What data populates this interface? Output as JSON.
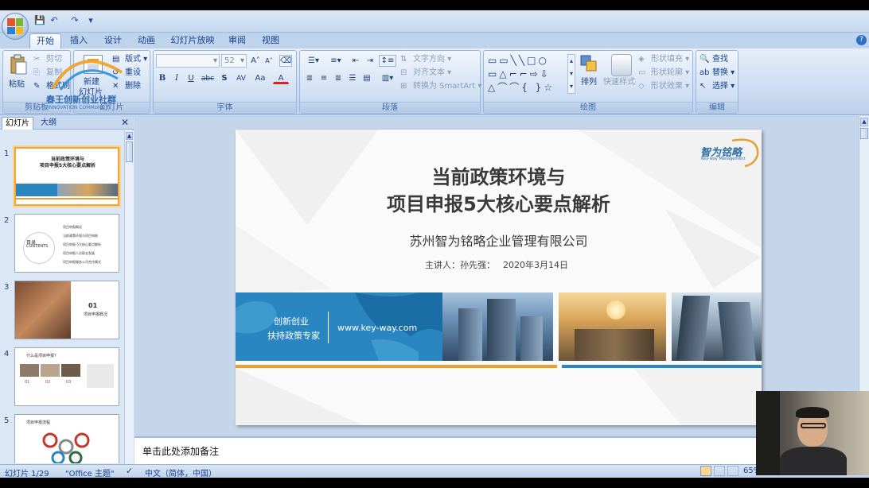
{
  "qat": {
    "save": "💾",
    "undo": "↶",
    "redo": "↷",
    "more": "▾"
  },
  "tabs": [
    "开始",
    "插入",
    "设计",
    "动画",
    "幻灯片放映",
    "审阅",
    "视图"
  ],
  "ribbon": {
    "clipboard": {
      "label": "剪贴板",
      "paste": "粘贴",
      "cut": "剪切",
      "copy": "复制",
      "format": "格式刷"
    },
    "slides": {
      "label": "幻灯片",
      "new": "新建",
      "new2": "幻灯片",
      "layout": "版式",
      "reset": "重设",
      "delete": "删除"
    },
    "font": {
      "label": "字体",
      "name": "",
      "size": "52",
      "bold": "B",
      "italic": "I",
      "underline": "U",
      "strike": "abc",
      "shadow": "S",
      "spacing": "AV",
      "case": "Aa",
      "color": "A",
      "grow": "A",
      "shrink": "A"
    },
    "paragraph": {
      "label": "段落",
      "direction": "文字方向",
      "align": "对齐文本",
      "smartart": "转换为 SmartArt"
    },
    "drawing": {
      "label": "绘图",
      "arrange": "排列",
      "quickstyle": "快速样式",
      "fill": "形状填充",
      "outline": "形状轮廓",
      "effect": "形状效果"
    },
    "editing": {
      "label": "编辑",
      "find": "查找",
      "replace": "替换",
      "select": "选择"
    }
  },
  "left_panel": {
    "tabs": [
      "幻灯片",
      "大纲"
    ],
    "thumbs": [
      {
        "num": "1",
        "line1": "当前政策环境与",
        "line2": "项目申报5大核心要点解析"
      },
      {
        "num": "2",
        "title": "目录",
        "sub": "CONTENTS",
        "items": [
          "项目申报概况",
          "当前政策环境与项目申报",
          "项目申报-5大核心要点解析",
          "项目申报人员职业发展",
          "项目申报服务公司合作模式"
        ]
      },
      {
        "num": "3",
        "code": "01",
        "text": "项目申报概况"
      },
      {
        "num": "4",
        "title": "什么是项目申报?",
        "cols": [
          "01",
          "02",
          "03"
        ]
      },
      {
        "num": "5",
        "title": "项目申报流程"
      }
    ]
  },
  "slide": {
    "title_line1": "当前政策环境与",
    "title_line2": "项目申报5大核心要点解析",
    "company": "苏州智为铭略企业管理有限公司",
    "presenter": "主讲人：孙先强：",
    "date": "2020年3月14日",
    "banner_line1": "创新创业",
    "banner_line2": "扶持政策专家",
    "url": "www.key-way.com",
    "logo_cn": "智为铭略",
    "logo_en": "Key-way Management"
  },
  "notes_placeholder": "单击此处添加备注",
  "status": {
    "slide": "幻灯片 1/29",
    "theme": "\"Office 主题\"",
    "lang": "中文（简体，中国）",
    "zoom": "65%"
  },
  "watermark": {
    "line1": "春王创新创业社群",
    "line2": "INNOVATION COMMUNITY"
  },
  "colors": {
    "accent_blue": "#2a7fb8",
    "orange": "#e8a030",
    "ribbon": "#c9daf0"
  }
}
